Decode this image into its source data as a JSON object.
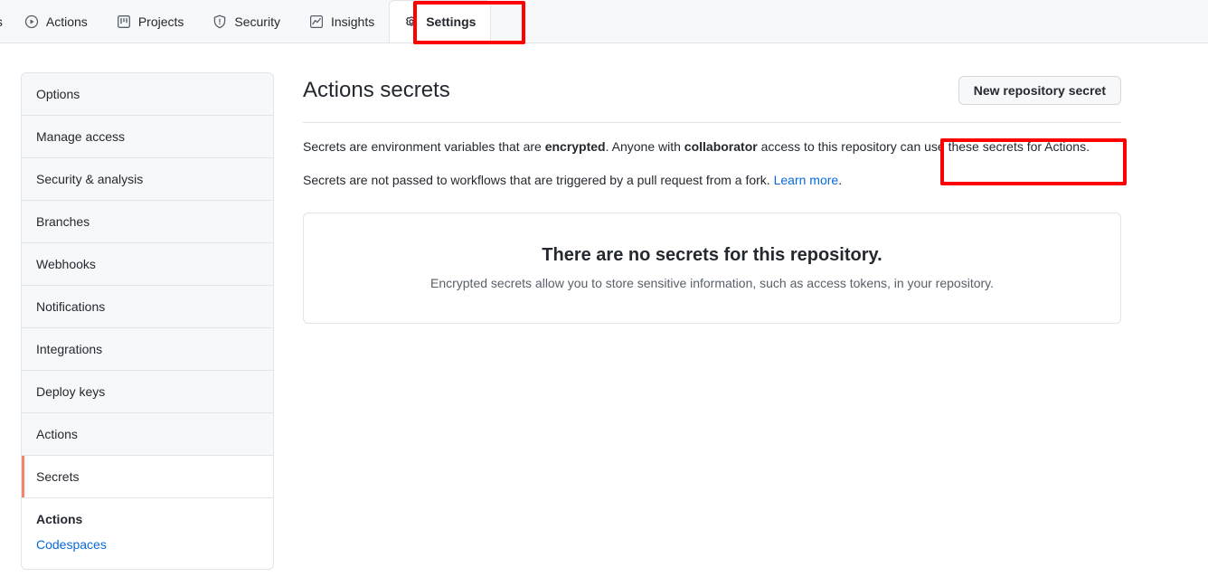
{
  "nav": {
    "partial_tab_text": "ts",
    "tabs": [
      {
        "label": "Actions",
        "icon": "play-circle-icon",
        "selected": false
      },
      {
        "label": "Projects",
        "icon": "project-board-icon",
        "selected": false
      },
      {
        "label": "Security",
        "icon": "shield-icon",
        "selected": false
      },
      {
        "label": "Insights",
        "icon": "graph-icon",
        "selected": false
      },
      {
        "label": "Settings",
        "icon": "gear-icon",
        "selected": true
      }
    ]
  },
  "sidebar": {
    "items": [
      {
        "label": "Options",
        "selected": false
      },
      {
        "label": "Manage access",
        "selected": false
      },
      {
        "label": "Security & analysis",
        "selected": false
      },
      {
        "label": "Branches",
        "selected": false
      },
      {
        "label": "Webhooks",
        "selected": false
      },
      {
        "label": "Notifications",
        "selected": false
      },
      {
        "label": "Integrations",
        "selected": false
      },
      {
        "label": "Deploy keys",
        "selected": false
      },
      {
        "label": "Actions",
        "selected": false
      },
      {
        "label": "Secrets",
        "selected": true
      }
    ],
    "subsection": {
      "heading": "Actions",
      "link": "Codespaces"
    }
  },
  "main": {
    "title": "Actions secrets",
    "new_secret_button": "New repository secret",
    "description_1": {
      "part_1": "Secrets are environment variables that are ",
      "bold_1": "encrypted",
      "part_2": ". Anyone with ",
      "bold_2": "collaborator",
      "part_3": " access to this repository can use these secrets for Actions."
    },
    "description_2": {
      "part_1": "Secrets are not passed to workflows that are triggered by a pull request from a fork. ",
      "link": "Learn more",
      "part_2": "."
    },
    "blankslate": {
      "heading": "There are no secrets for this repository.",
      "text": "Encrypted secrets allow you to store sensitive information, such as access tokens, in your repository."
    }
  },
  "colors": {
    "annotation": "#ff0000",
    "selected_accent": "#f9826c",
    "link": "#0969da",
    "nav_background": "#f6f8fa",
    "border": "#e1e4e8"
  }
}
